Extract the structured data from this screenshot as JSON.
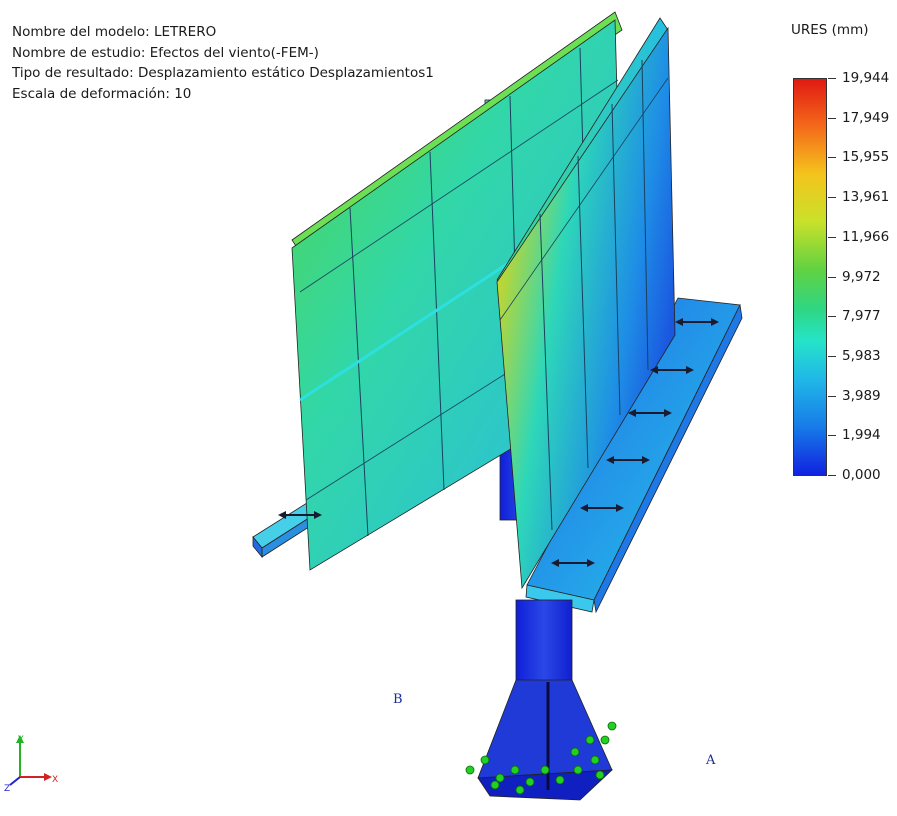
{
  "info": {
    "model_line": "Nombre del modelo: LETRERO",
    "study_line": "Nombre de estudio: Efectos del viento(-FEM-)",
    "result_line": "Tipo de resultado: Desplazamiento estático Desplazamientos1",
    "scale_line": "Escala de deformación: 10"
  },
  "legend": {
    "title": "URES (mm)",
    "ticks": [
      "19,944",
      "17,949",
      "15,955",
      "13,961",
      "11,966",
      "9,972",
      "7,977",
      "5,983",
      "3,989",
      "1,994",
      "0,000"
    ],
    "max_color": "#e01a12",
    "min_color": "#1122e0"
  },
  "points": {
    "a": "A",
    "b": "B"
  },
  "triad": {
    "y": "Y",
    "x": "X",
    "z": "Z"
  },
  "colors": {
    "background": "#ffffff",
    "support_blue": "#1f3ad6",
    "fixture_green": "#22d022"
  },
  "icons": [
    "coordinate-triad-icon",
    "fixture-icon",
    "load-arrow-icon"
  ]
}
